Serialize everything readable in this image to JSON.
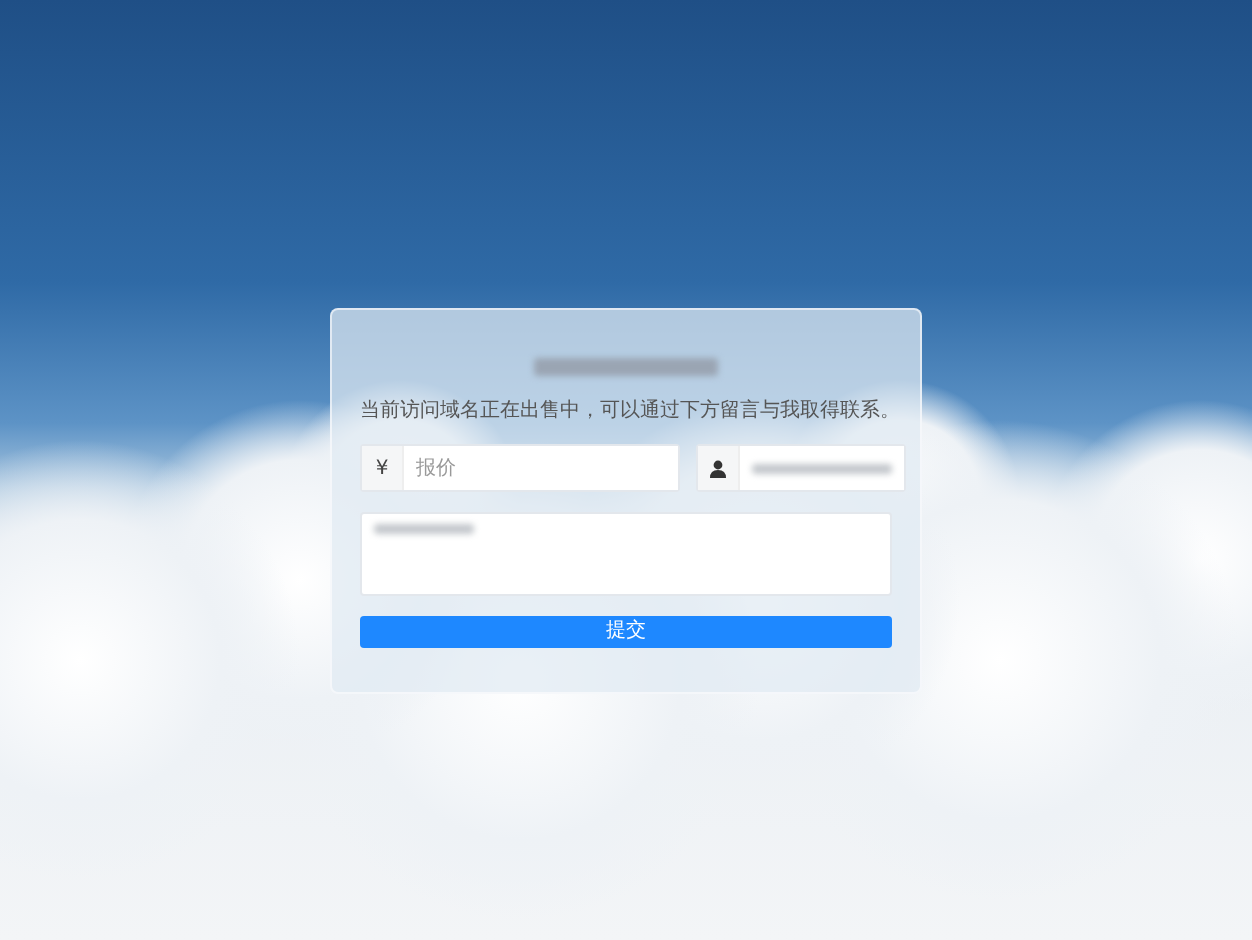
{
  "notice": "当前访问域名正在出售中，可以通过下方留言与我取得联系。",
  "form": {
    "price": {
      "prefix": "¥",
      "placeholder": "报价"
    },
    "submit": "提交"
  }
}
